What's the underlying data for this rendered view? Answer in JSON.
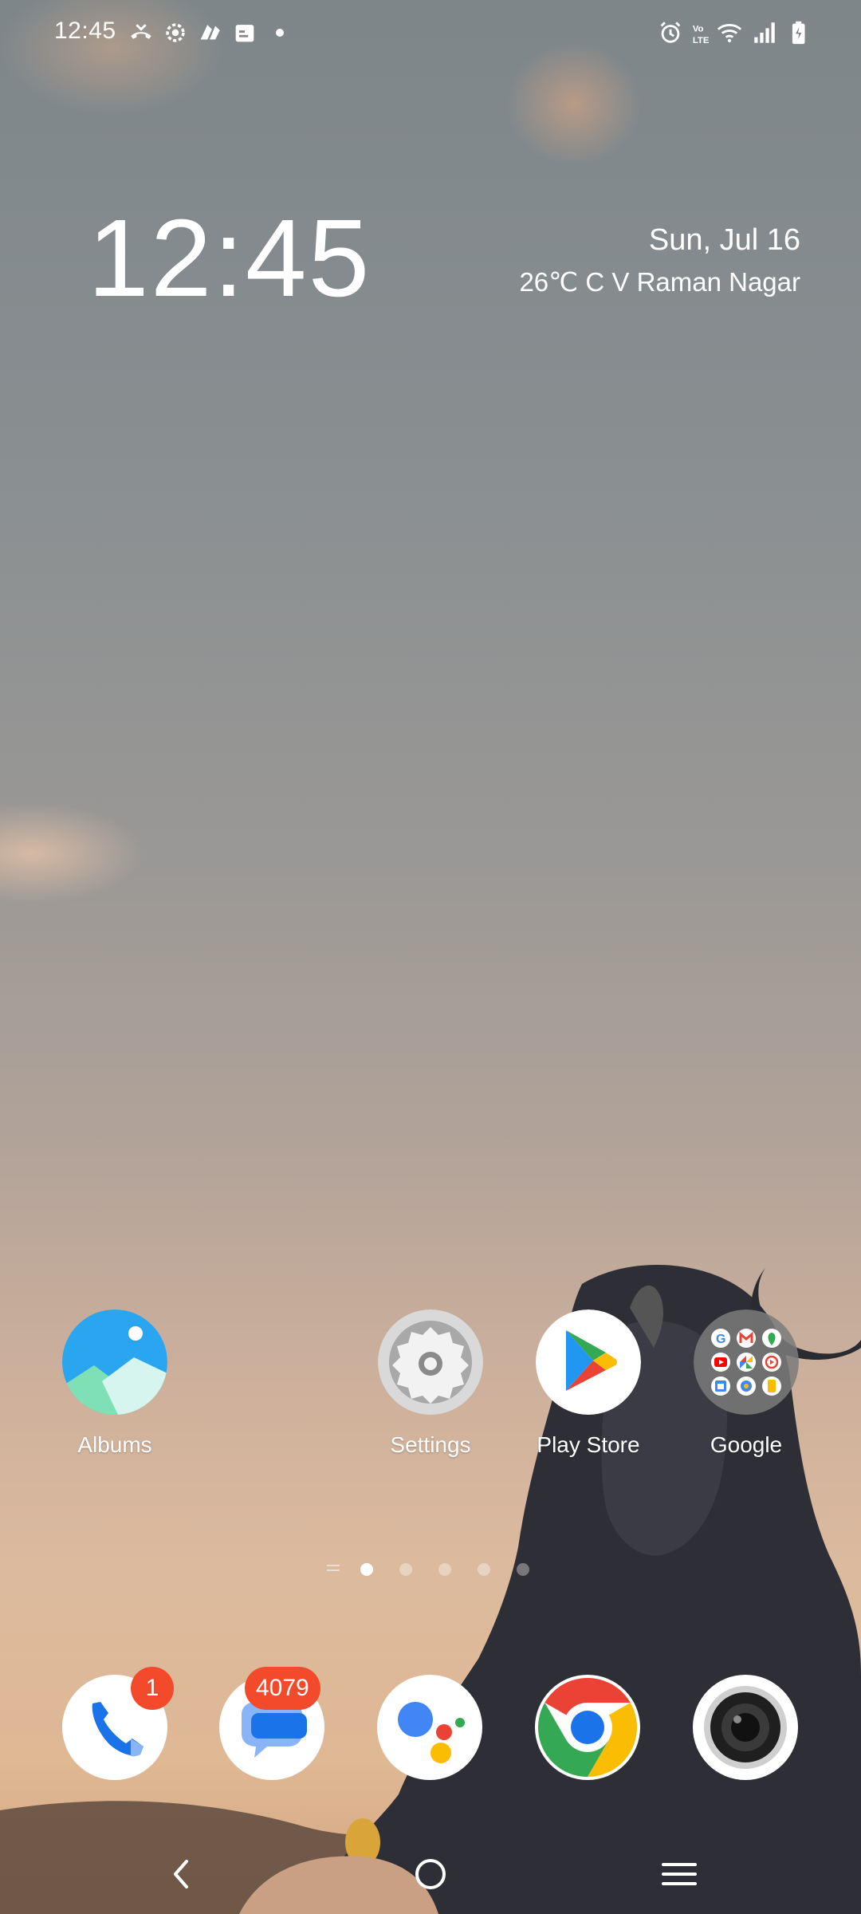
{
  "status_bar": {
    "time": "12:45",
    "left_icons": [
      "call-ended-icon",
      "gear-notification-icon",
      "app-notification-icon",
      "calendar-notification-icon",
      "more-dot-icon"
    ],
    "right_icons": [
      "alarm-icon",
      "volte-icon",
      "wifi-icon",
      "signal-icon",
      "battery-charging-icon"
    ]
  },
  "clock_widget": {
    "time": "12:45",
    "date": "Sun, Jul 16",
    "weather": "26℃  C V Raman Nagar"
  },
  "home_apps": [
    {
      "label": "Albums",
      "icon": "albums-icon"
    },
    {
      "label": "Settings",
      "icon": "settings-icon"
    },
    {
      "label": "Play Store",
      "icon": "play-store-icon"
    },
    {
      "label": "Google",
      "icon": "google-folder-icon"
    }
  ],
  "page_indicator": {
    "pages": 5,
    "current": 1
  },
  "dock": [
    {
      "name": "phone",
      "icon": "phone-icon",
      "badge": "1"
    },
    {
      "name": "messages",
      "icon": "messages-icon",
      "badge": "4079"
    },
    {
      "name": "assistant",
      "icon": "google-assistant-icon",
      "badge": ""
    },
    {
      "name": "chrome",
      "icon": "chrome-icon",
      "badge": ""
    },
    {
      "name": "camera",
      "icon": "camera-icon",
      "badge": ""
    }
  ],
  "nav_bar": {
    "buttons": [
      "back-icon",
      "home-icon",
      "recents-menu-icon"
    ]
  },
  "colors": {
    "badge": "#f24a2a",
    "text": "#ffffff"
  }
}
